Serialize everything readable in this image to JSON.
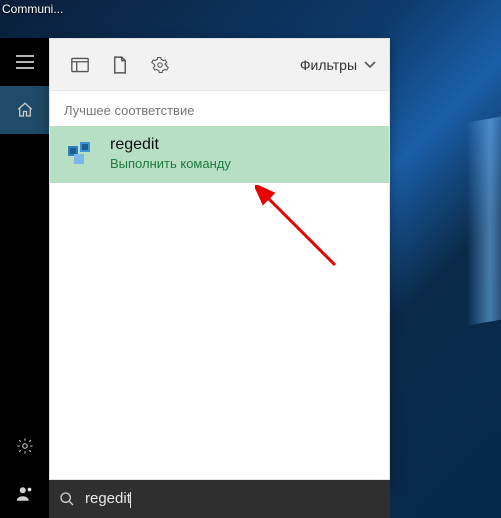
{
  "desktop": {
    "shortcut_label": "Communi..."
  },
  "sidebar": {
    "items": [
      "menu",
      "home",
      "settings",
      "user"
    ]
  },
  "panel": {
    "filters_label": "Фильтры",
    "section_label": "Лучшее соответствие",
    "result": {
      "title": "regedit",
      "subtitle": "Выполнить команду",
      "icon_name": "regedit-icon"
    }
  },
  "search": {
    "value": "regedit",
    "placeholder": ""
  },
  "colors": {
    "selection_bg": "#b7dfc4",
    "subtitle_green": "#1f7a3f",
    "arrow": "#e60000"
  }
}
